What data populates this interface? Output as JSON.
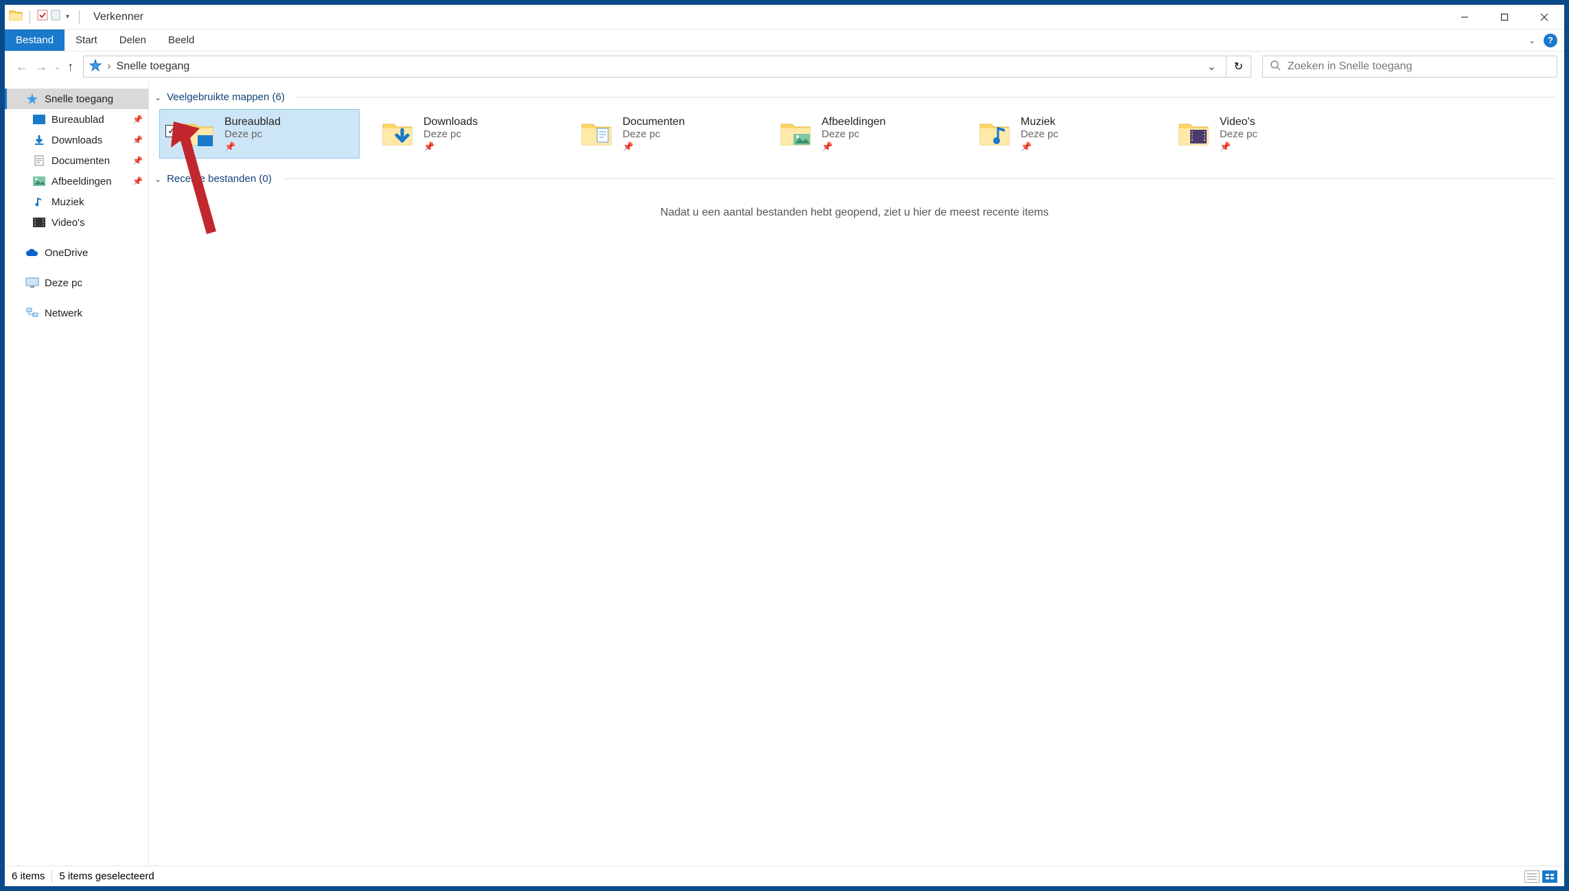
{
  "window": {
    "title": "Verkenner"
  },
  "ribbon": {
    "file": "Bestand",
    "tabs": [
      "Start",
      "Delen",
      "Beeld"
    ]
  },
  "nav": {
    "back_enabled": false,
    "forward_enabled": false
  },
  "breadcrumb": {
    "root_icon": "quick-access-star",
    "item": "Snelle toegang"
  },
  "search": {
    "placeholder": "Zoeken in Snelle toegang"
  },
  "sidebar": {
    "quick_access": {
      "label": "Snelle toegang",
      "selected": true
    },
    "items": [
      {
        "label": "Bureaublad",
        "icon": "desktop",
        "pinned": true
      },
      {
        "label": "Downloads",
        "icon": "downloads",
        "pinned": true
      },
      {
        "label": "Documenten",
        "icon": "documents",
        "pinned": true
      },
      {
        "label": "Afbeeldingen",
        "icon": "pictures",
        "pinned": true
      },
      {
        "label": "Muziek",
        "icon": "music",
        "pinned": false
      },
      {
        "label": "Video's",
        "icon": "videos",
        "pinned": false
      }
    ],
    "onedrive": "OneDrive",
    "thispc": "Deze pc",
    "network": "Netwerk"
  },
  "sections": {
    "frequent": {
      "label": "Veelgebruikte mappen",
      "count": 6
    },
    "recent": {
      "label": "Recente bestanden",
      "count": 0,
      "empty_message": "Nadat u een aantal bestanden hebt geopend, ziet u hier de meest recente items"
    }
  },
  "folders": [
    {
      "name": "Bureaublad",
      "location": "Deze pc",
      "icon": "desktop",
      "pinned": true,
      "selected": true
    },
    {
      "name": "Downloads",
      "location": "Deze pc",
      "icon": "downloads",
      "pinned": true,
      "selected": false
    },
    {
      "name": "Documenten",
      "location": "Deze pc",
      "icon": "documents",
      "pinned": true,
      "selected": false
    },
    {
      "name": "Afbeeldingen",
      "location": "Deze pc",
      "icon": "pictures",
      "pinned": true,
      "selected": false
    },
    {
      "name": "Muziek",
      "location": "Deze pc",
      "icon": "music",
      "pinned": true,
      "selected": false
    },
    {
      "name": "Video's",
      "location": "Deze pc",
      "icon": "videos",
      "pinned": true,
      "selected": false
    }
  ],
  "status": {
    "items": "6 items",
    "selected": "5 items geselecteerd"
  }
}
